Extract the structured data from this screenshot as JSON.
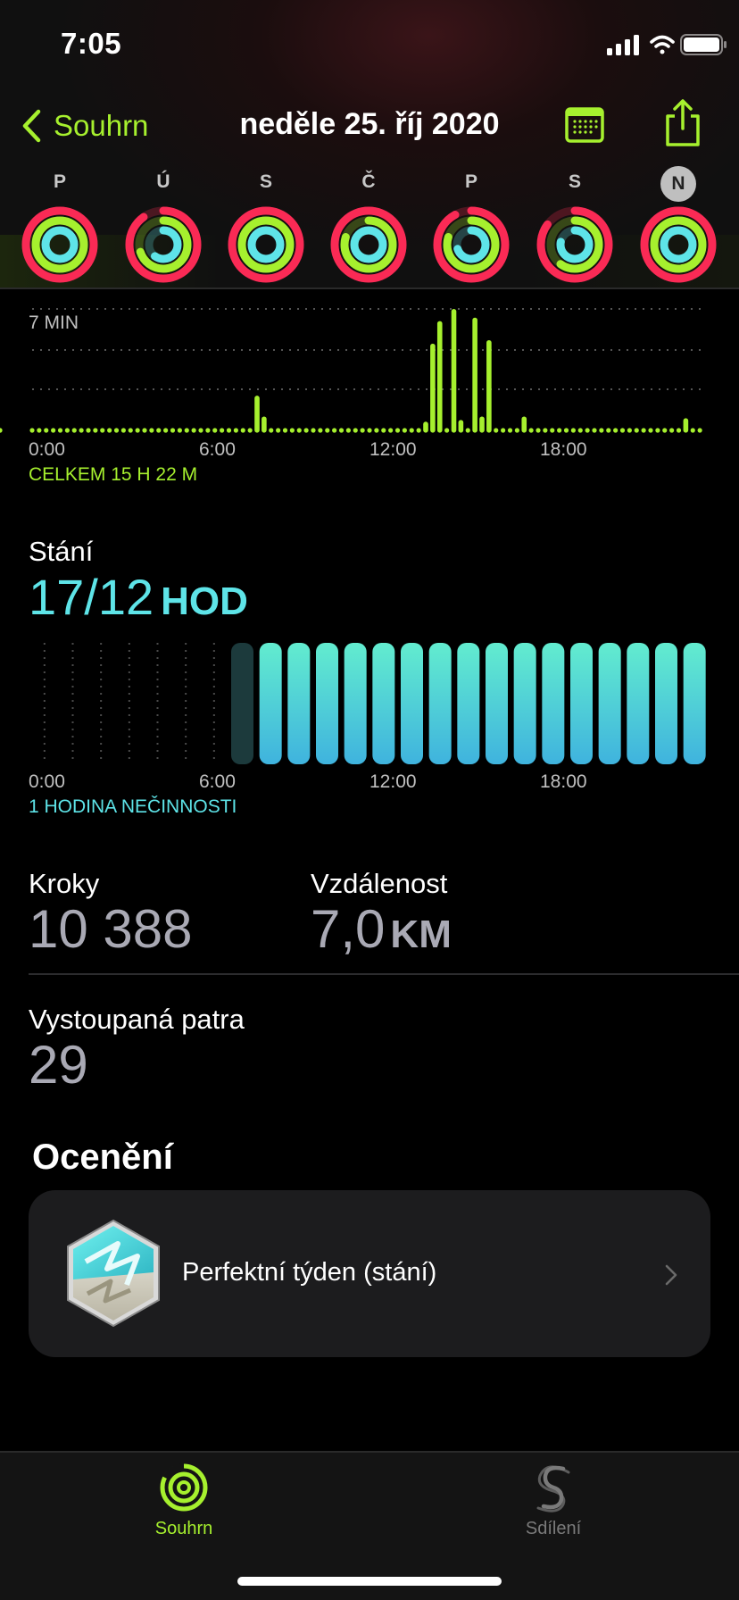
{
  "status_bar": {
    "time": "7:05"
  },
  "nav": {
    "back_label": "Souhrn",
    "title": "neděle 25. říj 2020"
  },
  "week": {
    "days": [
      {
        "label": "P",
        "move": 1.15,
        "exercise": 1.1,
        "stand": 1.05,
        "today": false
      },
      {
        "label": "Ú",
        "move": 0.9,
        "exercise": 0.7,
        "stand": 0.6,
        "today": false
      },
      {
        "label": "S",
        "move": 1.1,
        "exercise": 1.05,
        "stand": 1.05,
        "today": false
      },
      {
        "label": "Č",
        "move": 1.05,
        "exercise": 0.8,
        "stand": 1.02,
        "today": false
      },
      {
        "label": "P",
        "move": 0.92,
        "exercise": 0.8,
        "stand": 0.7,
        "today": false
      },
      {
        "label": "S",
        "move": 0.85,
        "exercise": 0.6,
        "stand": 0.78,
        "today": false
      },
      {
        "label": "N",
        "move": 1.15,
        "exercise": 1.12,
        "stand": 1.05,
        "today": true
      }
    ],
    "colors": {
      "move": "#fa2a55",
      "exercise": "#a6f02e",
      "stand": "#5ee4e8"
    }
  },
  "exercise": {
    "max_label": "7 MIN",
    "x_ticks": [
      "0:00",
      "6:00",
      "12:00",
      "18:00"
    ],
    "total_label": "CELKEM 15 H 22 M",
    "color": "#a6f02e"
  },
  "stand": {
    "title": "Stání",
    "value": "17/12",
    "unit": "HOD",
    "x_ticks": [
      "0:00",
      "6:00",
      "12:00",
      "18:00"
    ],
    "footer": "1 HODINA NEČINNOSTI",
    "color": "#5ee4e8"
  },
  "chart_data": [
    {
      "type": "bar",
      "title": "",
      "xlabel": "",
      "ylabel": "",
      "x_unit": "hour of day",
      "y_unit": "minutes",
      "ylim": [
        0,
        7
      ],
      "x": [
        0,
        0.25,
        0.5,
        0.75,
        1,
        1.25,
        1.5,
        1.75,
        2,
        2.25,
        2.5,
        2.75,
        3,
        3.25,
        3.5,
        3.75,
        4,
        4.25,
        4.5,
        4.75,
        5,
        5.25,
        5.5,
        5.75,
        6,
        6.25,
        6.5,
        6.75,
        7,
        7.25,
        7.5,
        7.75,
        8,
        8.25,
        8.5,
        8.75,
        9,
        9.25,
        9.5,
        9.75,
        10,
        10.25,
        10.5,
        10.75,
        11,
        11.25,
        11.5,
        11.75,
        12,
        12.25,
        12.5,
        12.75,
        13,
        13.25,
        13.5,
        13.75,
        14,
        14.25,
        14.5,
        14.75,
        15,
        15.25,
        15.5,
        15.75,
        16,
        16.25,
        16.5,
        16.75,
        17,
        17.25,
        17.5,
        17.75,
        18,
        18.25,
        18.5,
        18.75,
        19,
        19.25,
        19.5,
        19.75,
        20,
        20.25,
        20.5,
        20.75,
        21,
        21.25,
        21.5,
        21.75,
        22,
        22.25,
        22.5,
        22.75,
        23,
        23.25,
        23.5,
        23.75
      ],
      "values": [
        0,
        0,
        0,
        0,
        0,
        0,
        0,
        0,
        0,
        0,
        0,
        0,
        0,
        0,
        0,
        0,
        0,
        0,
        0,
        0,
        0,
        0,
        0,
        0,
        0,
        0,
        0,
        0,
        0,
        0,
        0,
        0,
        2,
        0.8,
        0,
        0,
        0,
        0,
        0,
        0,
        0,
        0,
        0,
        0,
        0,
        0,
        0,
        0,
        0,
        0,
        0,
        0,
        0,
        0,
        0,
        0,
        0.5,
        5,
        6.3,
        0,
        7,
        0.6,
        0,
        6.5,
        0.8,
        5.2,
        0,
        0,
        0,
        0,
        0.8,
        0,
        0,
        0,
        0,
        0,
        0,
        0,
        0,
        0,
        0,
        0,
        0,
        0,
        0,
        0,
        0,
        0,
        0,
        0,
        0,
        0,
        0,
        0.7,
        0,
        0,
        0,
        0
      ]
    },
    {
      "type": "bar",
      "title": "",
      "xlabel": "",
      "ylabel": "",
      "x_unit": "hour of day",
      "categories": [
        "0",
        "1",
        "2",
        "3",
        "4",
        "5",
        "6",
        "7",
        "8",
        "9",
        "10",
        "11",
        "12",
        "13",
        "14",
        "15",
        "16",
        "17",
        "18",
        "19",
        "20",
        "21",
        "22",
        "23"
      ],
      "values": [
        0,
        0,
        0,
        0,
        0,
        0,
        0,
        1,
        1,
        1,
        1,
        1,
        1,
        1,
        1,
        1,
        1,
        1,
        1,
        1,
        1,
        1,
        1,
        1
      ],
      "inactive_hours": [
        7
      ]
    }
  ],
  "stats": {
    "steps_label": "Kroky",
    "steps_value": "10 388",
    "distance_label": "Vzdálenost",
    "distance_value": "7,0",
    "distance_unit": "KM",
    "floors_label": "Vystoupaná patra",
    "floors_value": "29"
  },
  "awards": {
    "title": "Ocenění",
    "items": [
      {
        "label": "Perfektní týden (stání)"
      }
    ]
  },
  "tabbar": {
    "summary_label": "Souhrn",
    "sharing_label": "Sdílení"
  }
}
